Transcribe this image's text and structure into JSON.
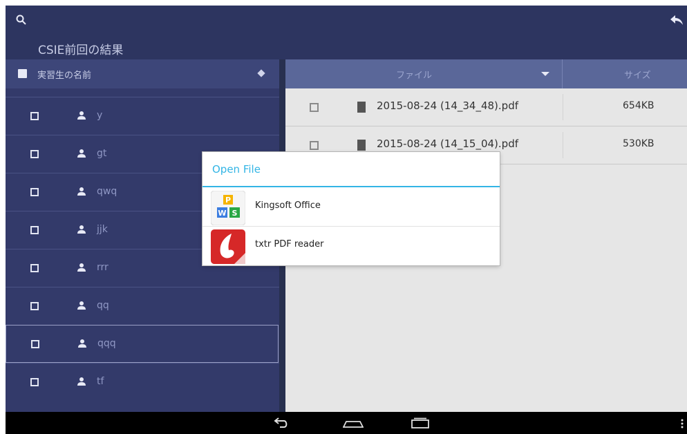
{
  "topbar": {
    "title": "CSIE前回の結果",
    "icons": [
      "search-icon",
      "reply-icon"
    ]
  },
  "left_panel": {
    "header_label": "実習生の名前",
    "students": [
      {
        "name": "y",
        "selected": false
      },
      {
        "name": "gt",
        "selected": false
      },
      {
        "name": "qwq",
        "selected": false
      },
      {
        "name": "jjk",
        "selected": false
      },
      {
        "name": "rrr",
        "selected": false
      },
      {
        "name": "qq",
        "selected": false
      },
      {
        "name": "qqq",
        "selected": true
      },
      {
        "name": "tf",
        "selected": false
      }
    ]
  },
  "file_table": {
    "columns": {
      "file": "ファイル",
      "size": "サイズ"
    },
    "rows": [
      {
        "name": "2015-08-24 (14_34_48).pdf",
        "size": "654KB"
      },
      {
        "name": "2015-08-24 (14_15_04).pdf",
        "size": "530KB"
      }
    ]
  },
  "dialog": {
    "title": "Open File",
    "apps": [
      {
        "name": "Kingsoft Office",
        "icon": "kingsoft-office-icon"
      },
      {
        "name": "txtr PDF reader",
        "icon": "txtr-pdf-reader-icon"
      }
    ]
  },
  "navbar": {
    "icons": [
      "back-icon",
      "home-icon",
      "recent-apps-icon",
      "menu-icon"
    ]
  },
  "colors": {
    "accent": "#33b5e5",
    "topbar": "#2d3560",
    "panel": "#333a6a"
  }
}
